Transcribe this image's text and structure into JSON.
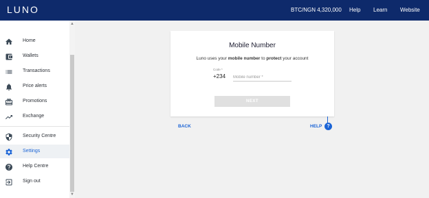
{
  "header": {
    "logo": "LUNO",
    "price_ticker": "BTC/NGN 4,320,000",
    "nav": [
      "Help",
      "Learn",
      "Website"
    ]
  },
  "sidebar": {
    "items": [
      {
        "label": "Home",
        "icon": "home-icon"
      },
      {
        "label": "Wallets",
        "icon": "wallet-icon"
      },
      {
        "label": "Transactions",
        "icon": "list-icon"
      },
      {
        "label": "Price alerts",
        "icon": "bell-icon"
      },
      {
        "label": "Promotions",
        "icon": "gift-icon"
      },
      {
        "label": "Exchange",
        "icon": "trending-icon"
      },
      {
        "label": "Security Centre",
        "icon": "shield-icon"
      },
      {
        "label": "Settings",
        "icon": "gear-icon",
        "active": true
      },
      {
        "label": "Help Centre",
        "icon": "help-icon"
      },
      {
        "label": "Sign out",
        "icon": "signout-icon"
      }
    ]
  },
  "card": {
    "title": "Mobile Number",
    "subtitle_prefix": "Luno uses your ",
    "subtitle_bold1": "mobile number",
    "subtitle_mid": " to ",
    "subtitle_bold2": "protect",
    "subtitle_suffix": " your account",
    "code_label": "Code *",
    "code_value": "+234",
    "mobile_placeholder": "Mobile number *",
    "next_label": "NEXT"
  },
  "footer_links": {
    "back": "BACK",
    "help": "HELP",
    "help_icon_glyph": "?"
  },
  "colors": {
    "header_bg": "#0e2a6b",
    "accent": "#1b64d6",
    "disabled_button": "#e0e0e0"
  }
}
